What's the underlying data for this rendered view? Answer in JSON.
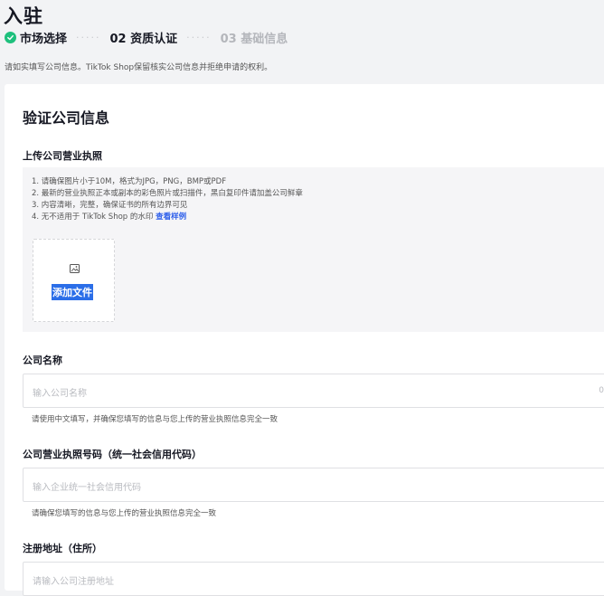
{
  "page": {
    "title": "入驻"
  },
  "steps": {
    "step1": "市场选择",
    "step2": "02 资质认证",
    "step3": "03 基础信息",
    "separator": "·····",
    "done_color": "#1ec07d"
  },
  "notice": "请如实填写公司信息。TikTok Shop保留核实公司信息并拒绝申请的权利。",
  "form": {
    "title": "验证公司信息",
    "license_upload": {
      "label": "上传公司营业执照",
      "requirements": [
        "1. 请确保图片小于10M，格式为JPG，PNG，BMP或PDF",
        "2. 最新的营业执照正本或副本的彩色照片或扫描件，黑白复印件请加盖公司鲜章",
        "3. 内容清晰，完整，确保证书的所有边界可见",
        "4. 无不适用于 TikTok Shop 的水印"
      ],
      "sample_link": "查看样例",
      "add_file": "添加文件",
      "icon": "image-icon"
    },
    "company_name": {
      "label": "公司名称",
      "placeholder": "输入公司名称",
      "counter": "0",
      "hint": "请使用中文填写，并确保您填写的信息与您上传的营业执照信息完全一致"
    },
    "license_number": {
      "label": "公司营业执照号码（统一社会信用代码）",
      "placeholder": "输入企业统一社会信用代码",
      "hint": "请确保您填写的信息与您上传的营业执照信息完全一致"
    },
    "address": {
      "label": "注册地址（住所）",
      "placeholder": "请输入公司注册地址"
    }
  }
}
